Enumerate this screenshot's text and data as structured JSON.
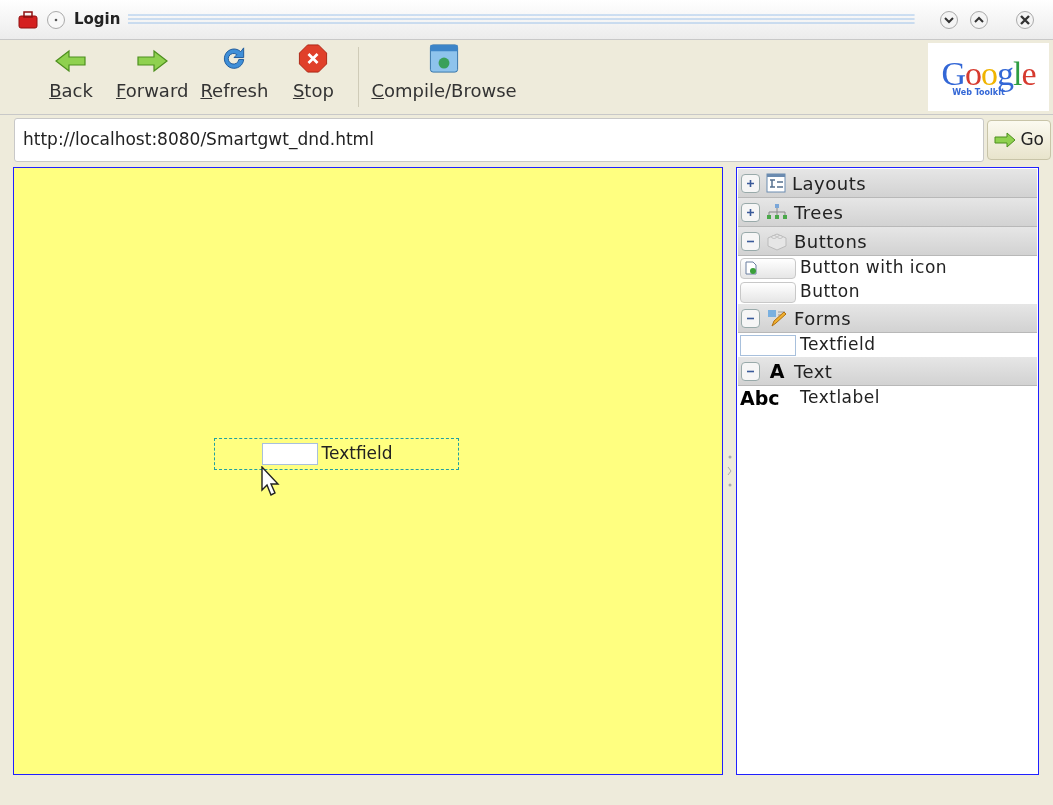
{
  "window": {
    "title": "Login"
  },
  "toolbar": [
    {
      "kind": "back",
      "key": "B",
      "rest": "ack"
    },
    {
      "kind": "forward",
      "key": "F",
      "rest": "orward"
    },
    {
      "kind": "refresh",
      "key": "R",
      "rest": "efresh"
    },
    {
      "kind": "stop",
      "key": "S",
      "rest": "top"
    },
    {
      "kind": "compile",
      "key": "C",
      "rest": "ompile/Browse"
    }
  ],
  "logo": {
    "name": "Google",
    "subtitle": "Web Toolkit"
  },
  "address": {
    "value": "http://localhost:8080/Smartgwt_dnd.html",
    "go": "Go"
  },
  "canvas": {
    "dropped": {
      "kind": "textfield",
      "label": "Textfield"
    }
  },
  "palette": [
    {
      "title": "Layouts",
      "kind": "layouts",
      "expanded": false
    },
    {
      "title": "Trees",
      "kind": "trees",
      "expanded": false
    },
    {
      "title": "Buttons",
      "kind": "buttons",
      "expanded": true,
      "items": [
        {
          "kind": "icon-button",
          "label": "Button with icon"
        },
        {
          "kind": "button",
          "label": "Button"
        }
      ]
    },
    {
      "title": "Forms",
      "kind": "forms",
      "expanded": true,
      "items": [
        {
          "kind": "textfield",
          "label": "Textfield"
        }
      ]
    },
    {
      "title": "Text",
      "kind": "letter",
      "glyph": "A",
      "expanded": true,
      "items": [
        {
          "kind": "label",
          "preview": "Abc",
          "label": "Textlabel"
        }
      ]
    }
  ]
}
